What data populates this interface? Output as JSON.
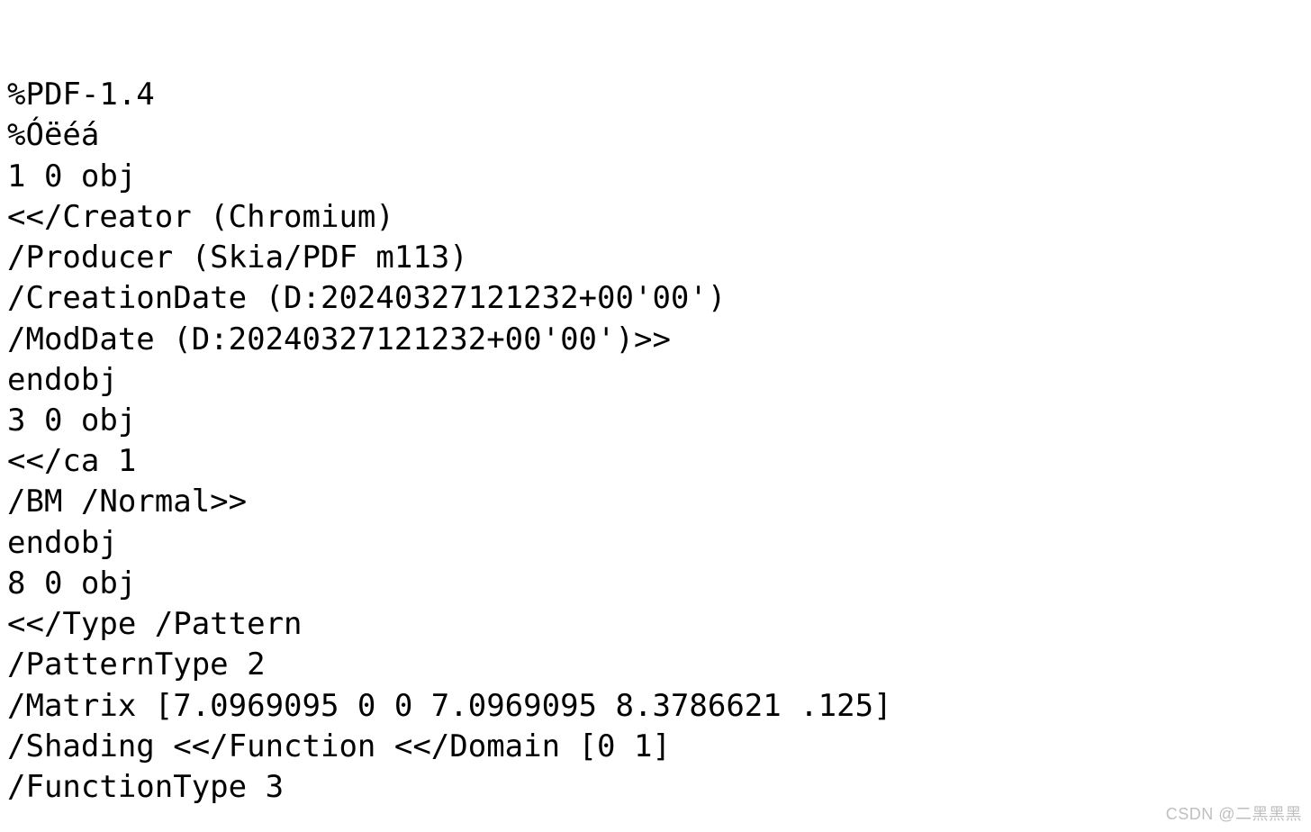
{
  "lines": [
    "%PDF-1.4",
    "%Óëéá",
    "1 0 obj",
    "<</Creator (Chromium)",
    "/Producer (Skia/PDF m113)",
    "/CreationDate (D:20240327121232+00'00')",
    "/ModDate (D:20240327121232+00'00')>>",
    "endobj",
    "3 0 obj",
    "<</ca 1",
    "/BM /Normal>>",
    "endobj",
    "8 0 obj",
    "<</Type /Pattern",
    "/PatternType 2",
    "/Matrix [7.0969095 0 0 7.0969095 8.3786621 .125]",
    "/Shading <</Function <</Domain [0 1]",
    "/FunctionType 3"
  ],
  "watermark": "CSDN @二黑黑黑"
}
